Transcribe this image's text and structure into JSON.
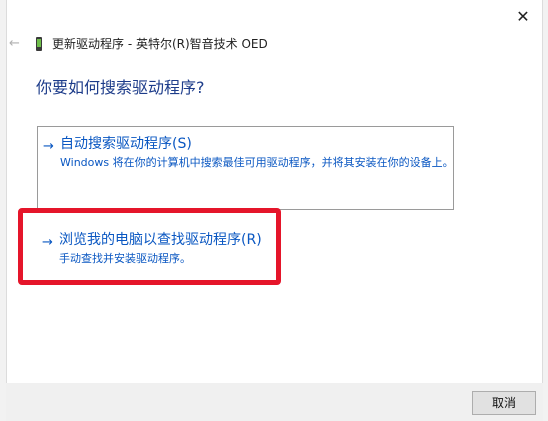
{
  "header": {
    "title": "更新驱动程序 - 英特尔(R)智音技术 OED",
    "back_icon": "←",
    "close_icon": "✕"
  },
  "main": {
    "question": "你要如何搜索驱动程序?",
    "options": [
      {
        "arrow": "→",
        "title": "自动搜索驱动程序(S)",
        "description": "Windows 将在你的计算机中搜索最佳可用驱动程序，并将其安装在你的设备上。"
      },
      {
        "arrow": "→",
        "title": "浏览我的电脑以查找驱动程序(R)",
        "description": "手动查找并安装驱动程序。",
        "highlighted": true
      }
    ]
  },
  "footer": {
    "cancel_label": "取消"
  },
  "colors": {
    "link": "#0a57c2",
    "question": "#1d3c8a",
    "highlight": "#e5152a",
    "footer_bg": "#f0f0f0"
  }
}
